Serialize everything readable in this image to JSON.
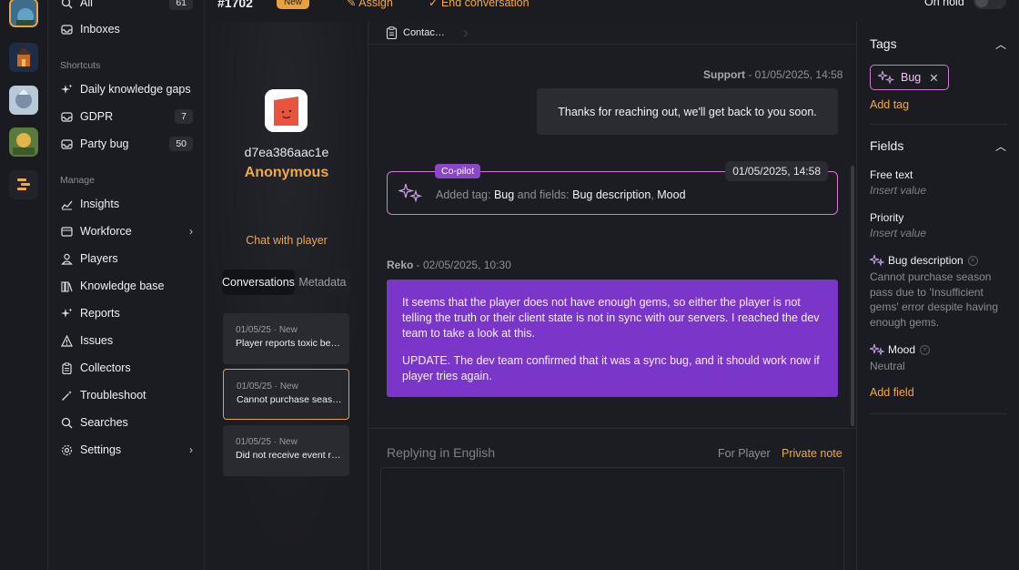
{
  "topbar": {
    "conversation_id": "#1702",
    "status_badge": "New",
    "assign": "Assign",
    "end_conversation": "End conversation",
    "on_hold": "On hold"
  },
  "nav": {
    "all": {
      "label": "All",
      "count": "61"
    },
    "inboxes": "Inboxes",
    "shortcuts_heading": "Shortcuts",
    "shortcuts": [
      {
        "label": "Daily knowledge gaps",
        "count": ""
      },
      {
        "label": "GDPR",
        "count": "7"
      },
      {
        "label": "Party bug",
        "count": "50"
      }
    ],
    "manage_heading": "Manage",
    "manage": [
      "Insights",
      "Workforce",
      "Players",
      "Knowledge base",
      "Reports",
      "Issues",
      "Collectors",
      "Troubleshoot",
      "Searches",
      "Settings"
    ]
  },
  "profile": {
    "player_id": "d7ea386aac1e",
    "player_name": "Anonymous",
    "chat_link": "Chat with player",
    "tabs": [
      "Conversations",
      "Metadata"
    ],
    "conversations": [
      {
        "meta": "01/05/25 · New",
        "title": "Player reports toxic be…"
      },
      {
        "meta": "01/05/25 · New",
        "title": "Cannot purchase seas…"
      },
      {
        "meta": "01/05/25 · New",
        "title": "Did not receive event r…"
      }
    ]
  },
  "main": {
    "breadcrumb": "Contac…",
    "support_sender": "Support",
    "support_time": " - 01/05/2025, 14:58",
    "support_text": "Thanks for reaching out, we'll get back to you soon.",
    "copilot_label": "Co-pilot",
    "copilot_time": "01/05/2025, 14:58",
    "copilot_text": {
      "prefix": "Added tag: ",
      "tag": "Bug",
      "mid": " and fields: ",
      "field1": "Bug description",
      "sep": ", ",
      "field2": "Mood"
    },
    "agent_sender": "Reko",
    "agent_time": " - 02/05/2025, 10:30",
    "agent_para1": "It seems that the player does not have enough gems, so either the player is not telling the truth or their client state is not in sync with our servers. I reached the dev team to take a look at this.",
    "agent_para2": "UPDATE. The dev team confirmed that it was a sync bug, and it should work now if player tries again.",
    "reply_lang": "Replying in English",
    "reply_for_player": "For Player",
    "reply_private_note": "Private note"
  },
  "right": {
    "tags_title": "Tags",
    "tag": "Bug",
    "add_tag": "Add tag",
    "fields_title": "Fields",
    "fields": [
      {
        "label": "Free text",
        "value": "Insert value"
      },
      {
        "label": "Priority",
        "value": "Insert value"
      },
      {
        "label": "Bug description",
        "value": "Cannot purchase season pass due to 'Insufficient gems' error despite having enough gems."
      },
      {
        "label": "Mood",
        "value": "Neutral"
      }
    ],
    "add_field": "Add field"
  },
  "colors": {
    "accent": "#f0a945",
    "copilot_purple": "#8a45c9",
    "agent_bubble": "#7a36c9",
    "copilot_border": "#d27ad6"
  }
}
